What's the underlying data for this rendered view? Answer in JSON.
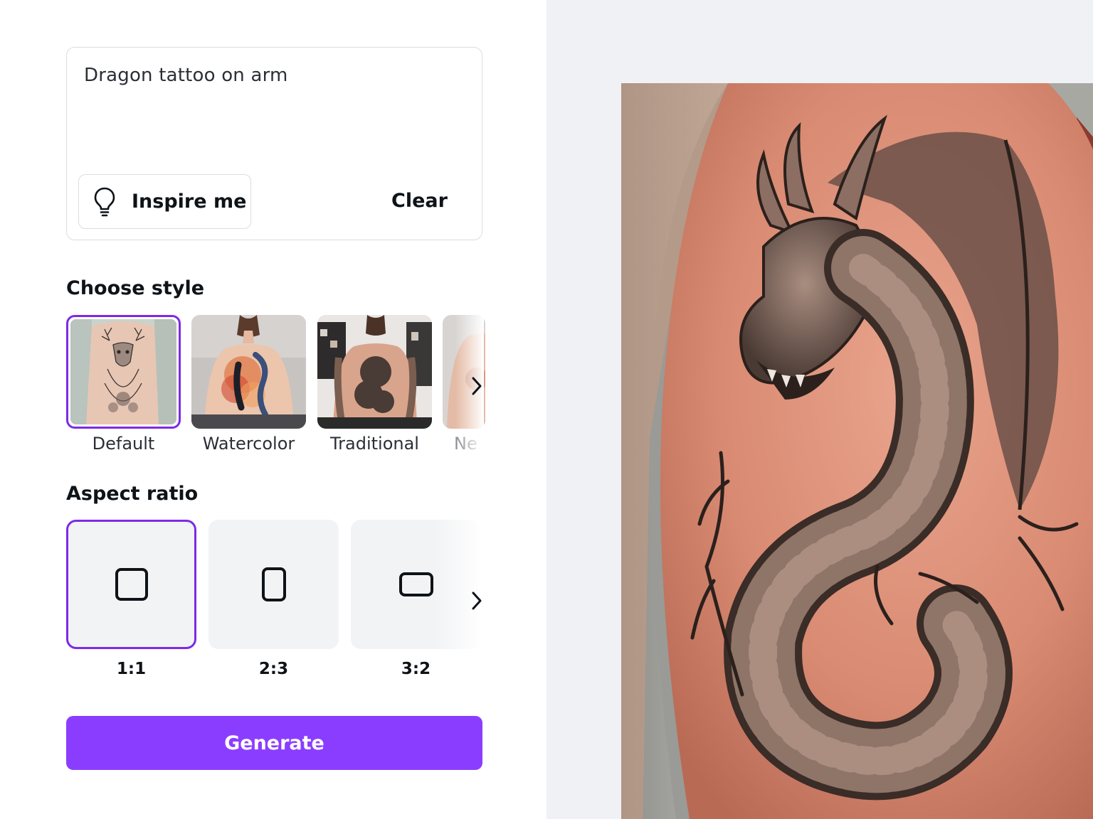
{
  "prompt": {
    "value": "Dragon tattoo on arm",
    "inspire_label": "Inspire me",
    "clear_label": "Clear"
  },
  "style_section": {
    "title": "Choose style",
    "selected": "Default",
    "items": [
      {
        "label": "Default"
      },
      {
        "label": "Watercolor"
      },
      {
        "label": "Traditional"
      },
      {
        "label": "Ne"
      }
    ]
  },
  "ratio_section": {
    "title": "Aspect ratio",
    "selected": "1:1",
    "items": [
      {
        "label": "1:1"
      },
      {
        "label": "2:3"
      },
      {
        "label": "3:2"
      }
    ]
  },
  "generate_label": "Generate",
  "colors": {
    "accent": "#7d2ae8",
    "generate": "#8b3dff",
    "panel_bg": "#f0f1f5"
  },
  "result_image_alt": "generated-dragon-tattoo-image"
}
